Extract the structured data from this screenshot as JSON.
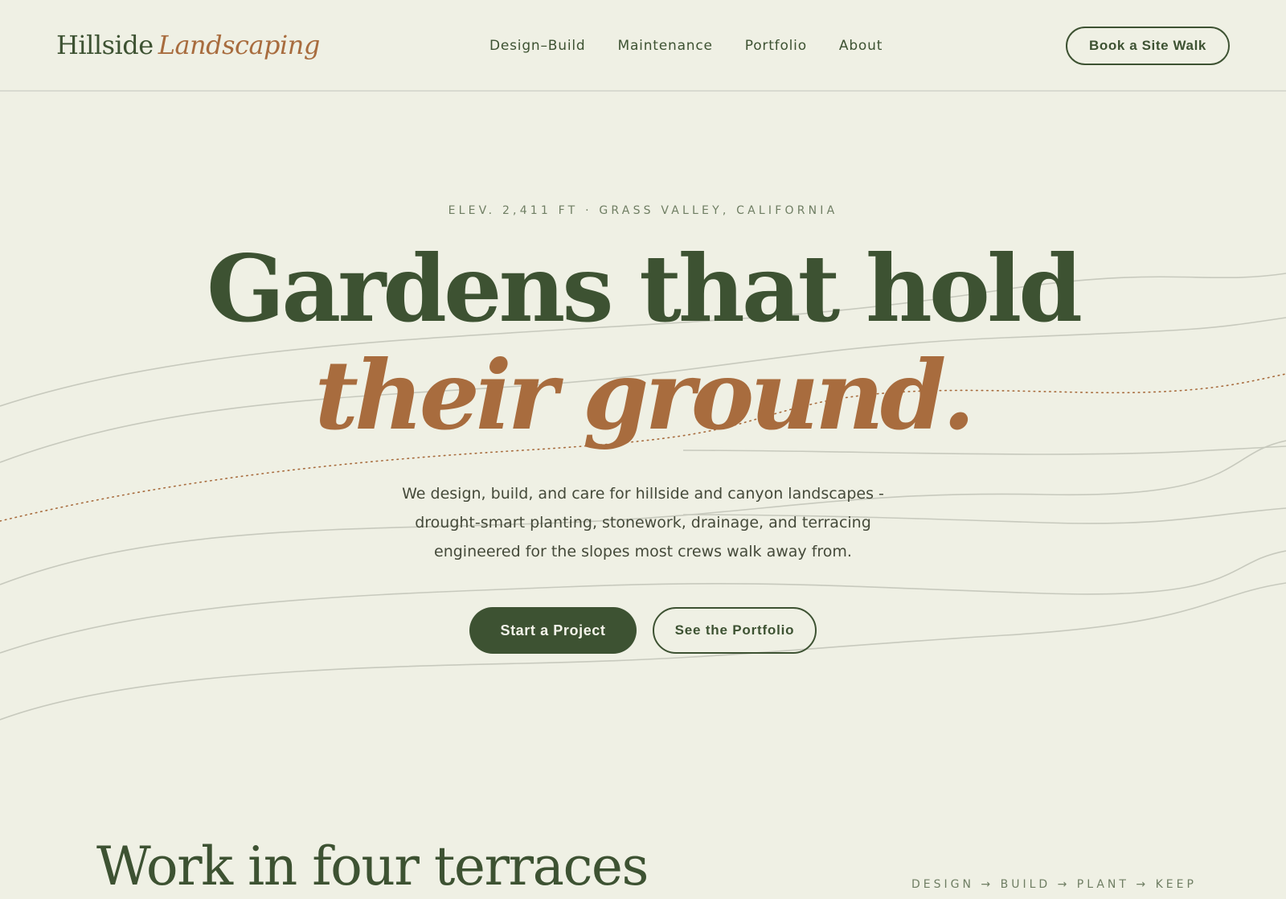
{
  "brand": {
    "name_first": "Hillside",
    "name_second": "Landscaping"
  },
  "nav": {
    "links": [
      "Design–Build",
      "Maintenance",
      "Portfolio",
      "About"
    ],
    "cta": "Book a Site Walk"
  },
  "hero": {
    "eyebrow": "ELEV. 2,411 FT · GRASS VALLEY, CALIFORNIA",
    "headline_line1": "Gardens that hold",
    "headline_line2": "their ground.",
    "lead": "We design, build, and care for hillside and canyon landscapes - drought-smart planting, stonework, drainage, and terracing engineered for the slopes most crews walk away from.",
    "primary_cta": "Start a Project",
    "secondary_cta": "See the Portfolio"
  },
  "section": {
    "title": "Work in four terraces",
    "process": "DESIGN → BUILD → PLANT → KEEP"
  },
  "colors": {
    "background": "#eff0e4",
    "forest": "#3d5232",
    "terracotta": "#a86c3e",
    "contour": "#c7c9bd"
  }
}
